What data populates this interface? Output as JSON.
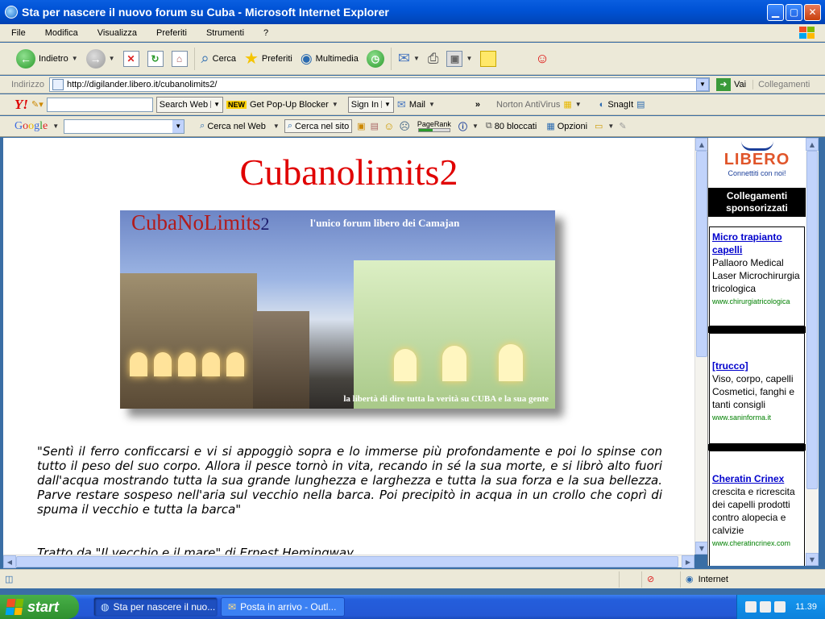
{
  "window": {
    "title": "Sta per nascere il nuovo forum su Cuba - Microsoft Internet Explorer"
  },
  "menu": [
    "File",
    "Modifica",
    "Visualizza",
    "Preferiti",
    "Strumenti",
    "?"
  ],
  "toolbar": {
    "back": "Indietro",
    "search": "Cerca",
    "favorites": "Preferiti",
    "multimedia": "Multimedia"
  },
  "address": {
    "label": "Indirizzo",
    "url": "http://digilander.libero.it/cubanolimits2/",
    "go": "Vai",
    "links": "Collegamenti"
  },
  "yahoo": {
    "search_btn": "Search Web",
    "new_badge": "NEW",
    "popup": "Get Pop-Up Blocker",
    "signin": "Sign In",
    "mail": "Mail",
    "more": "»",
    "norton": "Norton AntiVirus",
    "snagit": "SnagIt"
  },
  "google": {
    "search_web": "Cerca nel Web",
    "search_site": "Cerca nel sito",
    "pagerank": "PageRank",
    "blocked": "80 bloccati",
    "options": "Opzioni"
  },
  "page": {
    "title": "Cubanolimits2",
    "banner_logo": "CubaNoLimits",
    "banner_logo_suffix": "2",
    "banner_tagline": "l'unico forum libero dei Camajan",
    "banner_bottom": "la libertà di dire tutta la verità su CUBA e la sua gente",
    "quote": "\"Sentì il ferro conficcarsi e vi si appoggiò sopra e lo immerse più profondamente e poi lo spinse con tutto il peso del suo corpo. Allora il pesce tornò in vita, recando in sé la sua morte, e si librò alto fuori dall'acqua mostrando tutta la sua grande lunghezza e larghezza e tutta la sua forza e la sua bellezza. Parve restare sospeso nell'aria sul vecchio nella barca. Poi precipitò in acqua in un crollo che coprì di spuma il vecchio e tutta la barca\"",
    "attribution": "Tratto da \"Il vecchio e il mare\" di Ernest Hemingway"
  },
  "sidebar": {
    "logo": "LIBERO",
    "slogan": "Connettiti con noi!",
    "header": "Collegamenti sponsorizzati",
    "ads": [
      {
        "title": "Micro trapianto capelli",
        "text": "Pallaoro Medical Laser Microchirurgia tricologica",
        "url": "www.chirurgiatricologica"
      },
      {
        "title": "[trucco]",
        "text": "Viso, corpo, capelli Cosmetici, fanghi e tanti consigli",
        "url": "www.saninforma.it"
      },
      {
        "title": "Cheratin Crinex",
        "text": "crescita e ricrescita dei capelli prodotti contro alopecia e calvizie",
        "url": "www.cheratincrinex.com"
      }
    ]
  },
  "status": {
    "zone": "Internet"
  },
  "taskbar": {
    "start": "start",
    "tasks": [
      "Sta per nascere il nuo...",
      "Posta in arrivo - Outl..."
    ],
    "clock": "11.39"
  }
}
